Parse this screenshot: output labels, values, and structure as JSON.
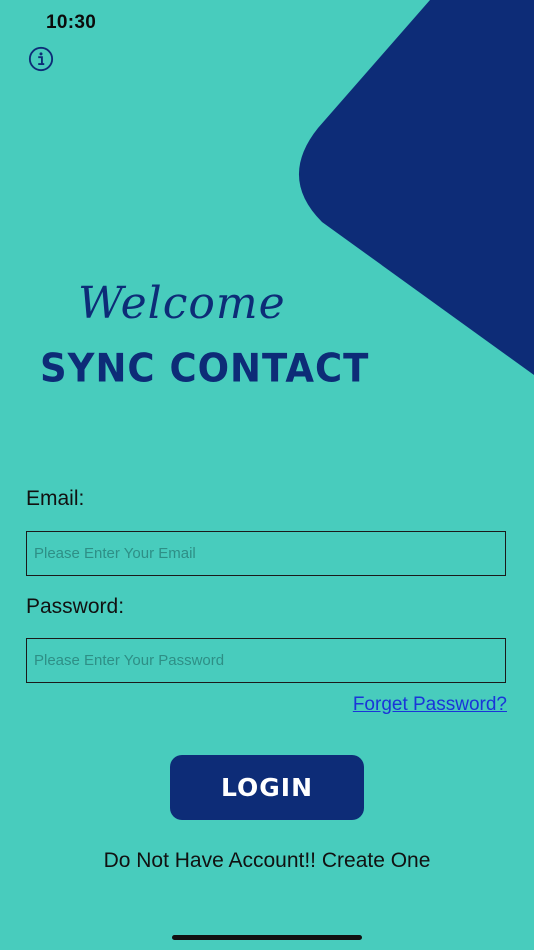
{
  "status_bar": {
    "time": "10:30"
  },
  "icons": {
    "info": "info-icon",
    "wifi": "wifi-icon",
    "battery": "battery-icon"
  },
  "hero": {
    "welcome": "Welcome",
    "app_name": "SYNC CONTACT"
  },
  "form": {
    "email_label": "Email:",
    "email_placeholder": "Please Enter Your Email",
    "email_value": "",
    "password_label": "Password:",
    "password_placeholder": "Please Enter Your Password",
    "password_value": "",
    "forgot_password": "Forget Password?",
    "login_button": "LOGIN",
    "create_account": "Do Not Have Account!! Create One"
  },
  "colors": {
    "background": "#48CCBD",
    "primary": "#0D2C77",
    "link": "#1A35D8"
  }
}
